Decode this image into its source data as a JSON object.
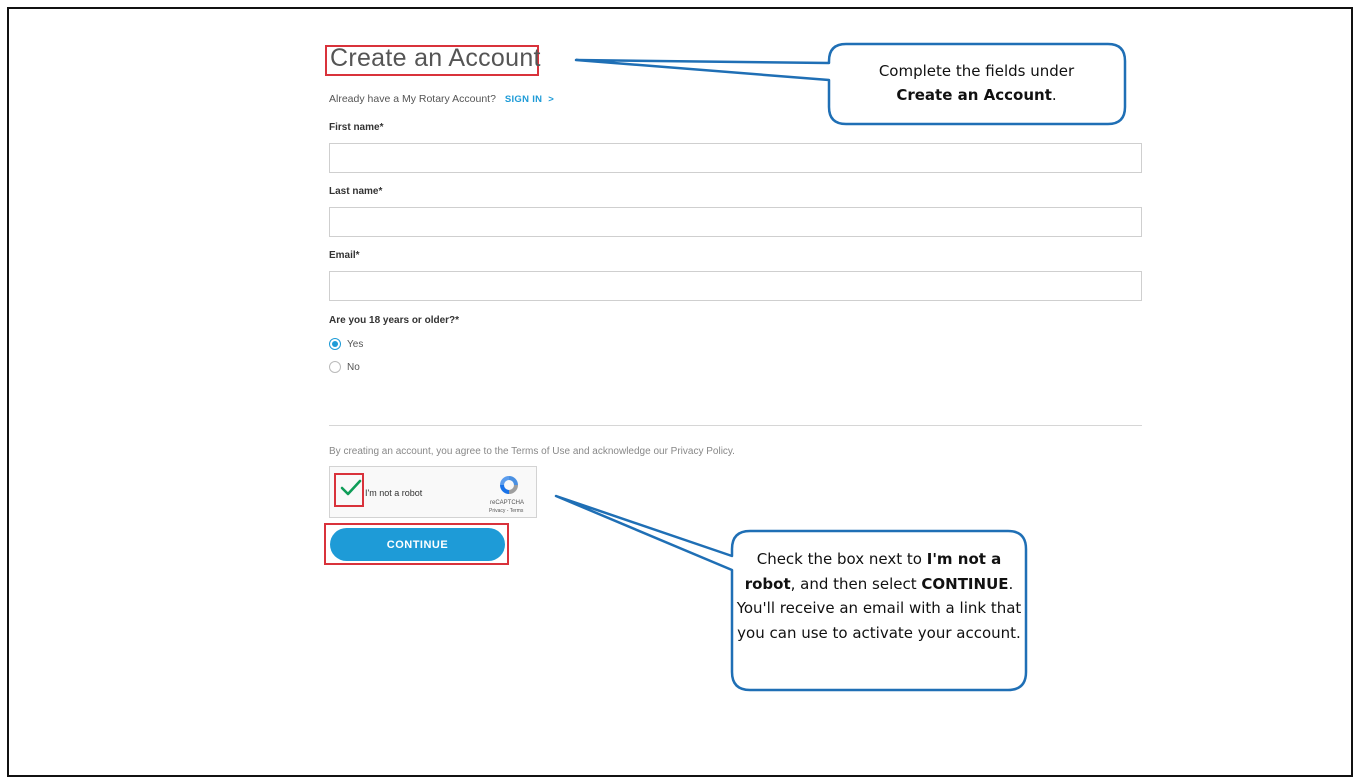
{
  "form": {
    "title": "Create an Account",
    "signin_prompt": "Already have a My Rotary Account?",
    "signin_link": "SIGN IN",
    "signin_chevron": ">",
    "first_name_label": "First name*",
    "last_name_label": "Last name*",
    "email_label": "Email*",
    "first_name_value": "",
    "last_name_value": "",
    "email_value": "",
    "age_question": "Are you 18 years or older?*",
    "age_options": [
      {
        "label": "Yes",
        "selected": true
      },
      {
        "label": "No",
        "selected": false
      }
    ],
    "terms_text": "By creating an account, you agree to the Terms of Use and acknowledge our Privacy Policy.",
    "captcha_label": "I'm not a robot",
    "captcha_checked": true,
    "recaptcha_brand": "reCAPTCHA",
    "recaptcha_links": "Privacy - Terms",
    "continue_label": "CONTINUE"
  },
  "callouts": {
    "top": {
      "line1": "Complete the fields under",
      "bold": "Create an Account",
      "suffix": "."
    },
    "bottom": {
      "p1": "Check the box next to ",
      "b1": "I'm not a robot",
      "p2": ", and then select ",
      "b2": "CONTINUE",
      "p3": ". You'll receive an email with a link that you can use to activate your account."
    }
  },
  "colors": {
    "accent": "#1e9bd7",
    "highlight": "#d9323b",
    "callout_border": "#1f6fb5"
  }
}
